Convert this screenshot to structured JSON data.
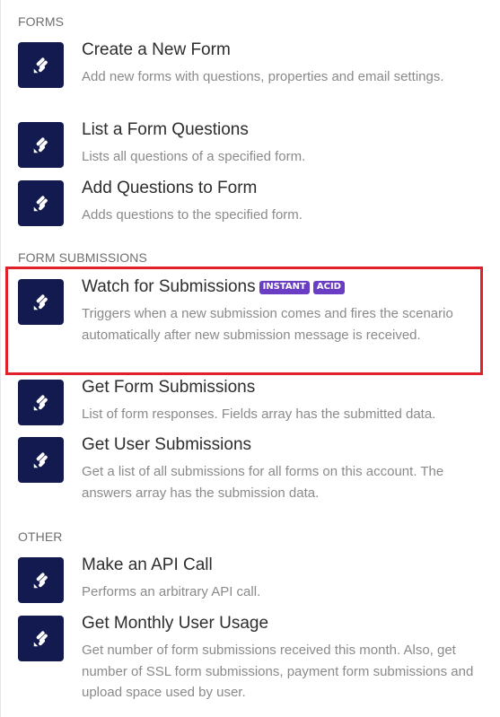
{
  "sections": [
    {
      "title": "FORMS"
    },
    {
      "title": "FORM SUBMISSIONS"
    },
    {
      "title": "OTHER"
    }
  ],
  "modules": [
    {
      "name": "Create a New Form",
      "desc": "Add new forms with questions, properties and email settings.",
      "icon": "jotform-icon"
    },
    {
      "name": "List a Form Questions",
      "desc": "Lists all questions of a specified form.",
      "icon": "jotform-icon"
    },
    {
      "name": "Add Questions to Form",
      "desc": "Adds questions to the specified form.",
      "icon": "jotform-icon"
    },
    {
      "name": "Watch for Submissions",
      "desc": "Triggers when a new submission comes and fires the scenario automatically after new submission message is received.",
      "icon": "jotform-icon",
      "badges": [
        "INSTANT",
        "ACID"
      ]
    },
    {
      "name": "Get Form Submissions",
      "desc": "List of form responses. Fields array has the submitted data.",
      "icon": "jotform-icon"
    },
    {
      "name": "Get User Submissions",
      "desc": "Get a list of all submissions for all forms on this account. The answers array has the submission data.",
      "icon": "jotform-icon"
    },
    {
      "name": "Make an API Call",
      "desc": "Performs an arbitrary API call.",
      "icon": "jotform-icon"
    },
    {
      "name": "Get Monthly User Usage",
      "desc": "Get number of form submissions received this month. Also, get number of SSL form submissions, payment form submissions and upload space used by user.",
      "icon": "jotform-icon"
    }
  ],
  "colors": {
    "icon_bg": "#121a4f",
    "badge_bg": "#6a3ec4",
    "highlight": "#e0202b"
  }
}
